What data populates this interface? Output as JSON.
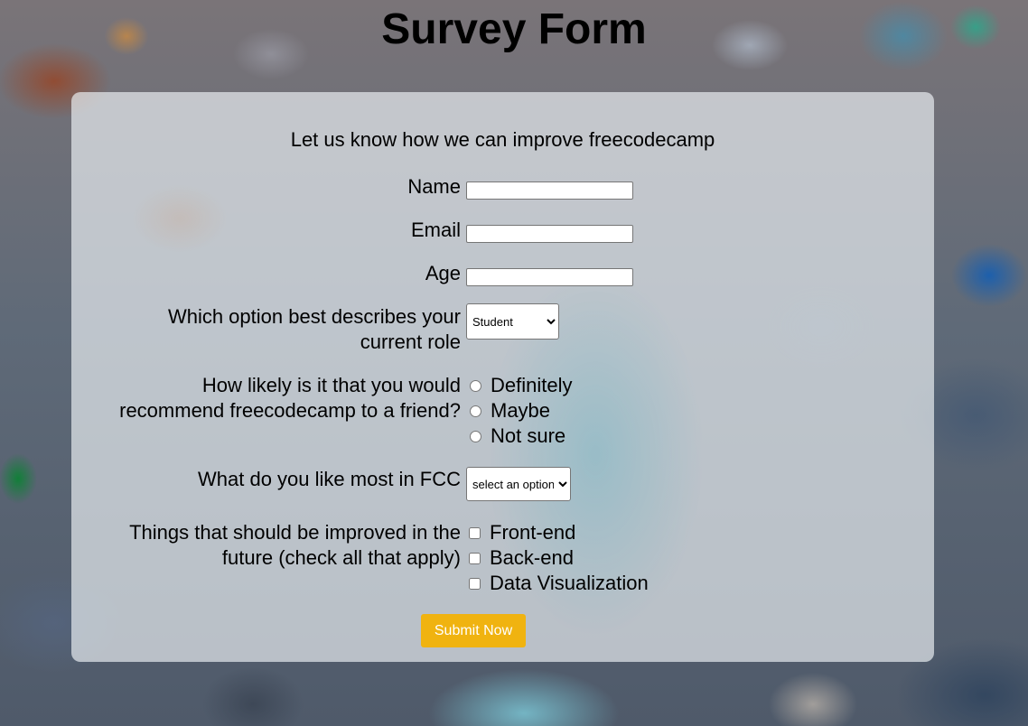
{
  "page": {
    "title": "Survey Form",
    "description": "Let us know how we can improve freecodecamp"
  },
  "form": {
    "name_label": "Name",
    "name_value": "",
    "email_label": "Email",
    "email_value": "",
    "age_label": "Age",
    "age_value": "",
    "role": {
      "label_line1": "Which option best describes your",
      "label_line2": "current role",
      "selected": "Student"
    },
    "recommend": {
      "label_line1": "How likely is it that you would",
      "label_line2": "recommend freecodecamp to a friend?",
      "options": [
        "Definitely",
        "Maybe",
        "Not sure"
      ]
    },
    "like_most": {
      "label": "What do you like most in FCC",
      "selected": "select an option"
    },
    "improve": {
      "label_line1": "Things that should be improved in the",
      "label_line2": "future (check all that apply)",
      "options": [
        "Front-end",
        "Back-end",
        "Data Visualization"
      ]
    },
    "submit_label": "Submit Now"
  },
  "colors": {
    "submit_button": "#f0b310",
    "submit_text": "#ffffff",
    "card_background": "rgba(240,244,247,0.66)"
  }
}
